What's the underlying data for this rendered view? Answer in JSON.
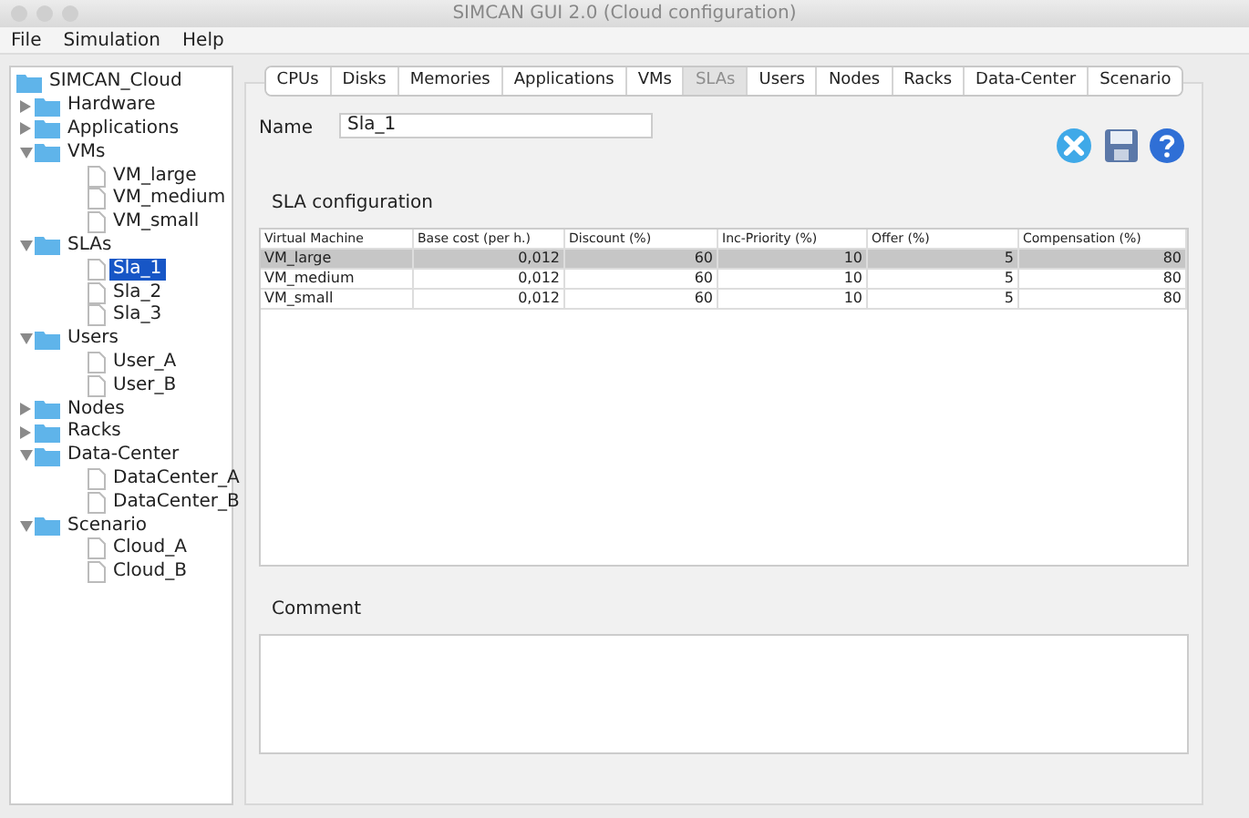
{
  "window": {
    "title": "SIMCAN GUI 2.0 (Cloud configuration)"
  },
  "menu": [
    "File",
    "Simulation",
    "Help"
  ],
  "tree": {
    "label": "SIMCAN_Cloud",
    "kind": "folder",
    "selected": false,
    "children": [
      {
        "label": "Hardware",
        "kind": "folder",
        "expanded": false,
        "selected": false
      },
      {
        "label": "Applications",
        "kind": "folder",
        "expanded": false,
        "selected": false
      },
      {
        "label": "VMs",
        "kind": "folder",
        "expanded": true,
        "selected": false,
        "children": [
          {
            "label": "VM_large",
            "kind": "leaf",
            "selected": false
          },
          {
            "label": "VM_medium",
            "kind": "leaf",
            "selected": false
          },
          {
            "label": "VM_small",
            "kind": "leaf",
            "selected": false
          }
        ]
      },
      {
        "label": "SLAs",
        "kind": "folder",
        "expanded": true,
        "selected": false,
        "children": [
          {
            "label": "Sla_1",
            "kind": "leaf",
            "selected": true
          },
          {
            "label": "Sla_2",
            "kind": "leaf",
            "selected": false
          },
          {
            "label": "Sla_3",
            "kind": "leaf",
            "selected": false
          }
        ]
      },
      {
        "label": "Users",
        "kind": "folder",
        "expanded": true,
        "selected": false,
        "children": [
          {
            "label": "User_A",
            "kind": "leaf",
            "selected": false
          },
          {
            "label": "User_B",
            "kind": "leaf",
            "selected": false
          }
        ]
      },
      {
        "label": "Nodes",
        "kind": "folder",
        "expanded": false,
        "selected": false
      },
      {
        "label": "Racks",
        "kind": "folder",
        "expanded": false,
        "selected": false
      },
      {
        "label": "Data-Center",
        "kind": "folder",
        "expanded": true,
        "selected": false,
        "children": [
          {
            "label": "DataCenter_A",
            "kind": "leaf",
            "selected": false
          },
          {
            "label": "DataCenter_B",
            "kind": "leaf",
            "selected": false
          }
        ]
      },
      {
        "label": "Scenario",
        "kind": "folder",
        "expanded": true,
        "selected": false,
        "children": [
          {
            "label": "Cloud_A",
            "kind": "leaf",
            "selected": false
          },
          {
            "label": "Cloud_B",
            "kind": "leaf",
            "selected": false
          }
        ]
      }
    ]
  },
  "tabs": [
    {
      "label": "CPUs",
      "selected": false
    },
    {
      "label": "Disks",
      "selected": false
    },
    {
      "label": "Memories",
      "selected": false
    },
    {
      "label": "Applications",
      "selected": false
    },
    {
      "label": "VMs",
      "selected": false
    },
    {
      "label": "SLAs",
      "selected": true
    },
    {
      "label": "Users",
      "selected": false
    },
    {
      "label": "Nodes",
      "selected": false
    },
    {
      "label": "Racks",
      "selected": false
    },
    {
      "label": "Data-Center",
      "selected": false
    },
    {
      "label": "Scenario",
      "selected": false
    }
  ],
  "name_field": {
    "label": "Name",
    "value": "Sla_1"
  },
  "section_title": "SLA configuration",
  "table": {
    "columns": [
      "Virtual Machine",
      "Base cost (per h.)",
      "Discount (%)",
      "Inc-Priority (%)",
      "Offer (%)",
      "Compensation (%)"
    ],
    "rows": [
      {
        "cells": [
          "VM_large",
          "0,012",
          "60",
          "10",
          "5",
          "80"
        ],
        "selected": true
      },
      {
        "cells": [
          "VM_medium",
          "0,012",
          "60",
          "10",
          "5",
          "80"
        ],
        "selected": false
      },
      {
        "cells": [
          "VM_small",
          "0,012",
          "60",
          "10",
          "5",
          "80"
        ],
        "selected": false
      }
    ]
  },
  "comment": {
    "label": "Comment"
  }
}
